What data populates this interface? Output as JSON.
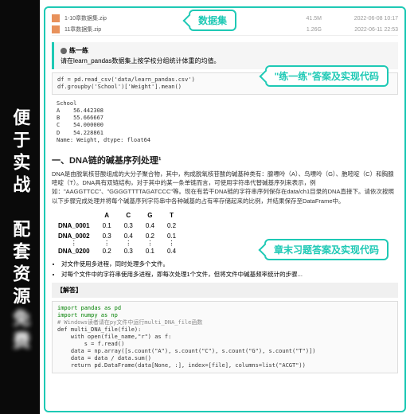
{
  "sidebar": {
    "line1": "便于实战",
    "gap": "　",
    "line2": "配套资源",
    "blurred": "免费"
  },
  "bubbles": {
    "top": "数据集",
    "mid": "\"练一练\"答案及实现代码",
    "bot": "章末习题答案及实现代码"
  },
  "files": [
    {
      "name": "1-10章数据集.zip",
      "meta": "41.5M",
      "date": "2022-06-08 10:17"
    },
    {
      "name": "11章数据集.zip",
      "meta": "1.26G",
      "date": "2022-06-11 22:53"
    }
  ],
  "exercise": {
    "title": "练一练",
    "desc": "请在learn_pandas数据集上按学校分组统计体重的均值。"
  },
  "code1": "df = pd.read_csv('data/learn_pandas.csv')\ndf.groupby('School')['Weight'].mean()",
  "output1": "School\nA    56.442308\nB    55.666667\nC    54.000000\nD    54.228861\nName: Weight, dtype: float64",
  "section": {
    "title": "一、DNA链的碱基序列处理¹"
  },
  "paragraph1": "DNA是由脱氧核苷酸组成的大分子聚合物，其中，构成脱氧核苷酸的碱基种类有：腺嘌呤（A）、鸟嘌呤（G）、胞嘧啶（C）和胸腺嘧啶（T）。DNA具有双链结构，对于其中的某一条单链而言，可使用字符串代替碱基序列来表示，例如：\"AAGGTTCC\"、\"GGGGTTTTAGATCCC\"等。现在有若干DNA链的字符串序列保存在data/ch1目录的DNA直接下。请依次按照以下步骤完成处理并将每个碱基序列字符串中各种碱基的占有率存储起来的比例，并结果保存至DataFrame中。",
  "dna_table": {
    "headers": [
      "",
      "A",
      "C",
      "G",
      "T"
    ],
    "rows": [
      {
        "name": "DNA_0001",
        "vals": [
          "0.1",
          "0.3",
          "0.4",
          "0.2"
        ]
      },
      {
        "name": "DNA_0002",
        "vals": [
          "0.3",
          "0.4",
          "0.2",
          "0.1"
        ]
      }
    ],
    "last": {
      "name": "DNA_0200",
      "vals": [
        "0.2",
        "0.3",
        "0.1",
        "0.4"
      ]
    }
  },
  "bullets": [
    "对文件使用多进程，同时处理多个文件。",
    "对每个文件中的字符串使用多进程，即每次处理1个文件，但将文件中碱基频率统计的步骤..."
  ],
  "hint": "【解答】",
  "code2_lines": [
    {
      "t": "import pandas as pd",
      "c": "kw"
    },
    {
      "t": "import numpy as np",
      "c": "kw"
    },
    {
      "t": "# Windows读者请在py文件中运行multi_DNA_file函数",
      "c": "cm"
    },
    {
      "t": "def multi_DNA_file(file):",
      "c": ""
    },
    {
      "t": "    with open(file_name,\"r\") as f:",
      "c": ""
    },
    {
      "t": "        s = f.read()",
      "c": ""
    },
    {
      "t": "    data = np.array([s.count(\"A\"), s.count(\"C\"), s.count(\"G\"), s.count(\"T\")])",
      "c": ""
    },
    {
      "t": "    data = data / data.sum()",
      "c": ""
    },
    {
      "t": "    return pd.DataFrame(data[None, :], index=[file], columns=list(\"ACGT\"))",
      "c": ""
    }
  ]
}
